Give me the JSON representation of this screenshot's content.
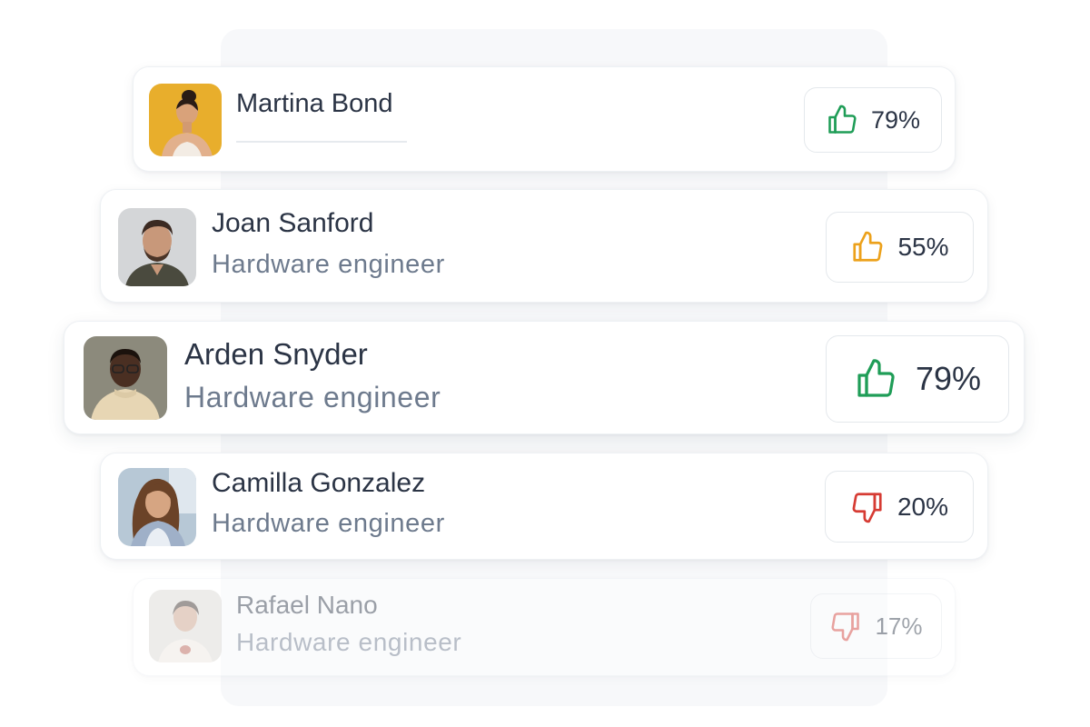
{
  "colors": {
    "thumb_up_green": "#1f9d57",
    "thumb_up_amber": "#eca11b",
    "thumb_down_red": "#d63b33",
    "name_text": "#2b3445",
    "role_text": "#6d7a8d"
  },
  "candidates": [
    {
      "name": "Martina Bond",
      "role": "",
      "score": "79%",
      "rating": "thumbs-up",
      "rating_color": "green"
    },
    {
      "name": "Joan Sanford",
      "role": "Hardware engineer",
      "score": "55%",
      "rating": "thumbs-up",
      "rating_color": "amber"
    },
    {
      "name": "Arden Snyder",
      "role": "Hardware engineer",
      "score": "79%",
      "rating": "thumbs-up",
      "rating_color": "green"
    },
    {
      "name": "Camilla Gonzalez",
      "role": "Hardware engineer",
      "score": "20%",
      "rating": "thumbs-down",
      "rating_color": "red"
    },
    {
      "name": "Rafael Nano",
      "role": "Hardware engineer",
      "score": "17%",
      "rating": "thumbs-down",
      "rating_color": "red"
    }
  ]
}
